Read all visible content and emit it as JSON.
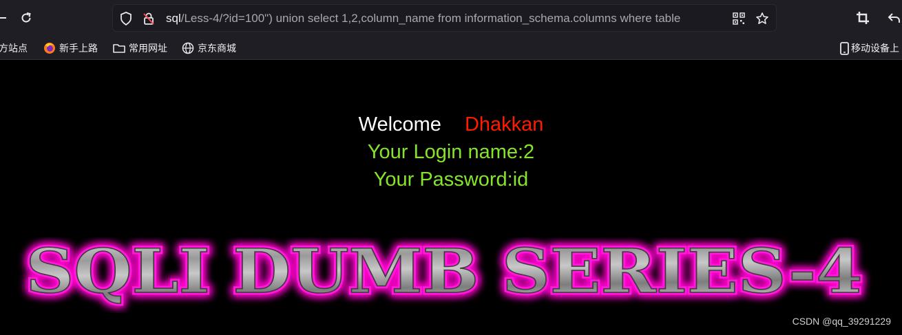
{
  "browser": {
    "url_host": "sql",
    "url_path": "/Less-4/?id=100\") union select 1,2,column_name from information_schema.columns where table"
  },
  "bookmarks": [
    {
      "label": "方站点"
    },
    {
      "label": "新手上路"
    },
    {
      "label": "常用网址"
    },
    {
      "label": "京东商城"
    },
    {
      "label": "移动设备上"
    }
  ],
  "page": {
    "welcome_label": "Welcome",
    "welcome_name": "Dhakkan",
    "login_line": "Your Login name:2",
    "password_line": "Your Password:id",
    "banner_text": "SQLI DUMB SERIES-4"
  },
  "watermark": "CSDN @qq_39291229",
  "colors": {
    "background": "#000000",
    "name_red": "#ff1a00",
    "result_green": "#86e42b",
    "banner_glow": "#ff00cc"
  }
}
